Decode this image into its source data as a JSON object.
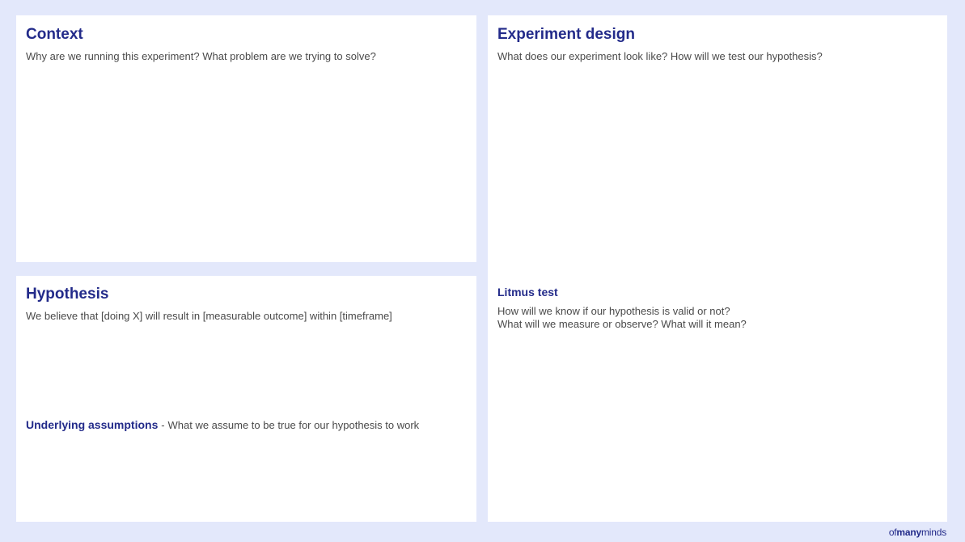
{
  "context": {
    "title": "Context",
    "description": "Why are we running this experiment? What problem are we trying to solve?"
  },
  "hypothesis": {
    "title": "Hypothesis",
    "description": "We believe that [doing X] will result in [measurable outcome] within [timeframe]",
    "assumptions_title": "Underlying assumptions",
    "assumptions_separator": "-",
    "assumptions_description": "What we assume to be true for our hypothesis to work"
  },
  "experiment": {
    "title": "Experiment design",
    "description": "What does our experiment look like? How will we test our hypothesis?",
    "litmus_title": "Litmus test",
    "litmus_line1": "How will we know if our hypothesis is valid or not?",
    "litmus_line2": "What will we measure or observe? What will it mean?"
  },
  "brand": {
    "prefix": "of",
    "bold": "many",
    "suffix": "minds"
  },
  "colors": {
    "background": "#e3e8fb",
    "panel": "#ffffff",
    "heading": "#232b8a",
    "body_text": "#4a4a4a"
  }
}
